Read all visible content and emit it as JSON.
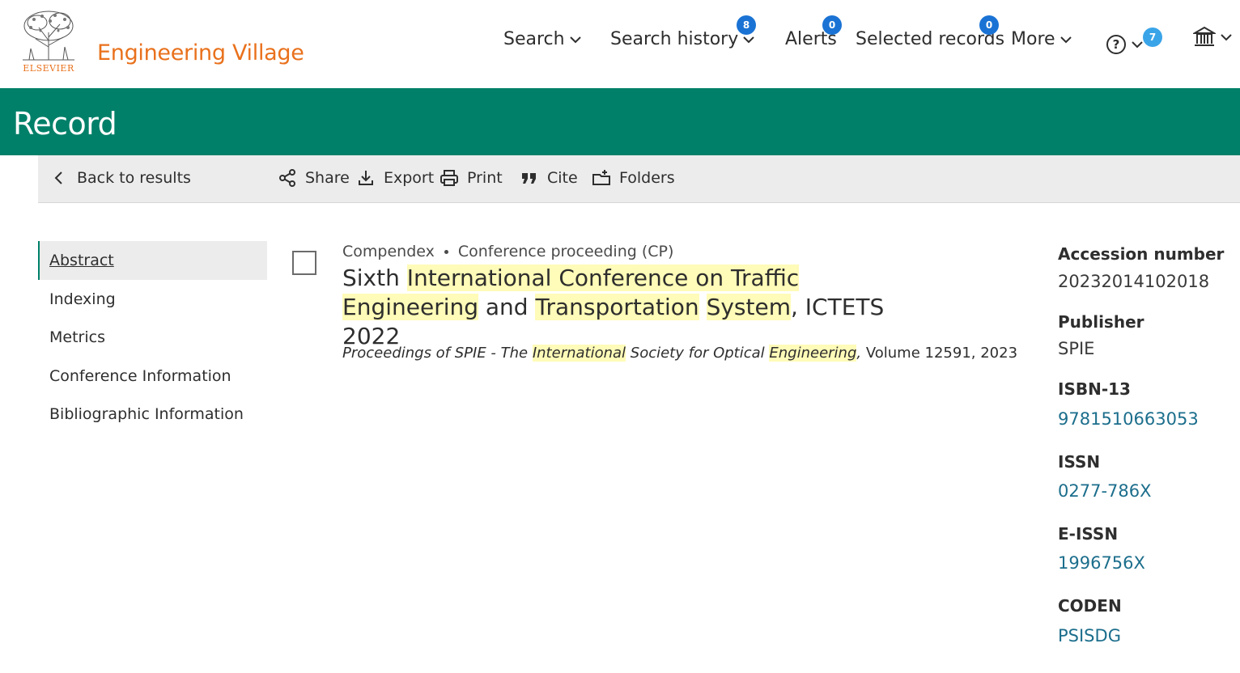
{
  "header": {
    "logo_text": "ELSEVIER",
    "app_title": "Engineering Village",
    "nav": {
      "search": "Search",
      "search_history": "Search history",
      "search_history_badge": "8",
      "alerts": "Alerts",
      "alerts_badge": "0",
      "selected_records": "Selected records",
      "selected_records_badge": "0",
      "more": "More",
      "help_badge": "7"
    }
  },
  "banner": {
    "title": "Record"
  },
  "toolbar": {
    "back": "Back to results",
    "share": "Share",
    "export": "Export",
    "print": "Print",
    "cite": "Cite",
    "folders": "Folders"
  },
  "sidenav": {
    "items": [
      "Abstract",
      "Indexing",
      "Metrics",
      "Conference Information",
      "Bibliographic Information"
    ]
  },
  "record": {
    "database": "Compendex",
    "doc_type": "Conference proceeding (CP)",
    "title_parts": [
      "Sixth ",
      "International Conference on Traffic Engineering",
      " and ",
      "Transportation",
      " ",
      "System",
      ", ICTETS 2022"
    ],
    "source_parts": [
      "Proceedings of SPIE - The ",
      "International",
      " Society for Optical ",
      "Engineering",
      ",",
      " Volume 12591, 2023"
    ]
  },
  "details": {
    "accession_label": "Accession number",
    "accession_value": "20232014102018",
    "publisher_label": "Publisher",
    "publisher_value": "SPIE",
    "isbn_label": "ISBN-13",
    "isbn_value": "9781510663053",
    "issn_label": "ISSN",
    "issn_value": "0277-786X",
    "eissn_label": "E-ISSN",
    "eissn_value": "1996756X",
    "coden_label": "CODEN",
    "coden_value": "PSISDG"
  },
  "colors": {
    "brand_orange": "#e9711c",
    "banner_green": "#008069",
    "badge_blue": "#1a73d4",
    "highlight": "#fffbb8",
    "link": "#1c6e8c"
  }
}
